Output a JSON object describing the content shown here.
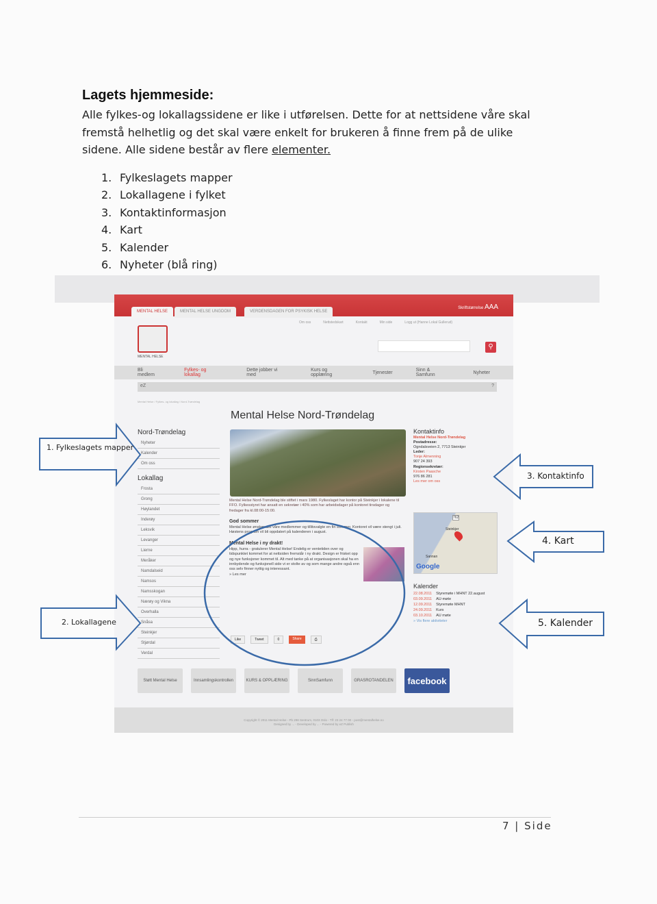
{
  "heading": "Lagets hjemmeside:",
  "intro": "Alle fylkes-og lokallagssidene er like i utførelsen. Dette for at nettsidene våre skal fremstå helhetlig og det skal være enkelt for brukeren å finne frem på de ulike sidene. Alle sidene består av flere ",
  "intro_link": "elementer.",
  "list": [
    {
      "n": "1.",
      "t": "Fylkeslagets mapper"
    },
    {
      "n": "2.",
      "t": "Lokallagene i fylket"
    },
    {
      "n": "3.",
      "t": "Kontaktinformasjon"
    },
    {
      "n": "4.",
      "t": "Kart"
    },
    {
      "n": "5.",
      "t": "Kalender"
    },
    {
      "n": "6.",
      "t": "Nyheter (blå ring)"
    }
  ],
  "site": {
    "tabs": [
      "MENTAL HELSE",
      "MENTAL HELSE UNGDOM",
      "VERDENSDAGEN FOR PSYKISK HELSE"
    ],
    "font_size_label": "Skriftstørrelse",
    "font_size_glyphs": "AAA",
    "top_links": [
      "Om oss",
      "Nettstedskart",
      "Kontakt",
      "Min side",
      "Logg ut (Hanne Lokal Gullerud)"
    ],
    "logo_text": "MENTAL HELSE",
    "search_icon": "magnifier-icon",
    "nav": [
      "Bli medlem",
      "Fylkes- og lokallag",
      "Dette jobber vi med",
      "Kurs og opplæring",
      "Tjenester",
      "Sinn & Samfunn",
      "Nyheter"
    ],
    "ez": "eZ",
    "ez_help": "?",
    "breadcrumb": "Mental Helse / Fylkes- og lokallag / Nord-Trøndelag",
    "page_title": "Mental Helse Nord-Trøndelag",
    "county": {
      "title": "Nord-Trøndelag",
      "items": [
        "Nyheter",
        "Kalender",
        "Om oss"
      ]
    },
    "local": {
      "title": "Lokallag",
      "items": [
        "Frosta",
        "Grong",
        "Høylandet",
        "Inderøy",
        "Leksvik",
        "Levanger",
        "Lierne",
        "Meråker",
        "Namdalseid",
        "Namsos",
        "Namsskogan",
        "Nærøy og Vikna",
        "Overhalla",
        "Snåsa",
        "Steinkjer",
        "Stjørdal",
        "Verdal"
      ]
    },
    "intro_text": "Mental Helse Nord-Trøndelag ble stiftet i mars 1980. Fylkeslaget har kontor på Steinkjer i lokalene til FFO. Fylkesstyret har ansatt en sekretær i 40% som har arbeidsdager på kontoret tirsdager og fredager fra kl.08:00-15:00.",
    "news": [
      {
        "title": "God sommer",
        "text": "Mental Helse ønsker alle våre medlemmer og tillitsvalgte en fin sommer. Kontoret vil være stengt i juli. Høstens program vil bli oppdatert på kalenderen i august."
      },
      {
        "title": "Mental Helse i ny drakt!",
        "text": "Hipp, hurra - gratulerer Mental Helse! Endelig er ventetiden over og tidspunktet kommet for at nettsiden fremstår i ny drakt. Design er frisket opp og nye funksjoner kommet til. Alt med tanke på at organisasjonen skal ha en innbydende og funksjonell side vi er stolte av og som mange andre også enn oss selv finner nyttig og interessant."
      }
    ],
    "read_more": "» Les mer",
    "share": {
      "like": "Like",
      "tweet": "Tweet",
      "count": "0",
      "share": "Share"
    },
    "contact": {
      "title": "Kontaktinfo",
      "org": "Mental Helse Nord-Trøndelag",
      "addr_label": "Postadresse:",
      "addr": "Ogndalsveien 2, 7713 Steinkjer",
      "leader_label": "Leder:",
      "leader": "Tonje Almenning",
      "leader_phone": "907 24 393",
      "sec_label": "Regionsekretær:",
      "sec": "Kirsten Paasche",
      "sec_phone": "976 86 281",
      "more": "Les mer om oss"
    },
    "map": {
      "brand": "Google",
      "places": [
        "Steinkjer",
        "Sannan",
        "762"
      ]
    },
    "calendar": {
      "title": "Kalender",
      "events": [
        {
          "d": "22.08.2011",
          "t": "Styremøte i MHNT 22.august"
        },
        {
          "d": "03.09.2011",
          "t": "AU-møte"
        },
        {
          "d": "12.09.2011",
          "t": "Styremøte MHNT"
        },
        {
          "d": "24.09.2011",
          "t": "Kurs"
        },
        {
          "d": "03.10.2011",
          "t": "AU møte"
        }
      ],
      "more": "» Vis flere aktiviteter"
    },
    "logos": [
      "Støtt Mental Helse",
      "Innsamlingskontrollen",
      "KURS & OPPLÆRING",
      "SinnSamfunn",
      "GRASROTANDELEN",
      "facebook"
    ],
    "footer": [
      "Copyright © 2011 Mental Helse - Pb 298 Sentrum, 0103 Oslo - Tlf: 23 24 77 00 - post@mentalhelse.no",
      "Designed by ... - Developed by ... - Powered by eZ Publish"
    ]
  },
  "callouts": [
    "1. Fylkeslagets mapper",
    "2. Lokallagene",
    "3. Kontaktinfo",
    "4. Kart",
    "5. Kalender"
  ],
  "annotation_color": "#3a6aa8",
  "page_number": "7 | Side"
}
